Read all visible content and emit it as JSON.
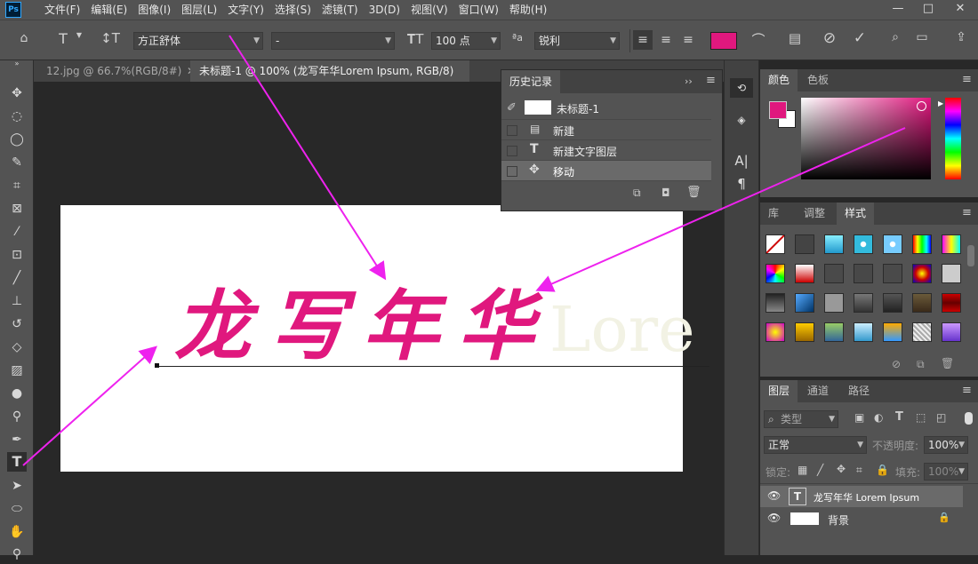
{
  "app": {
    "logo": "Ps",
    "brand_color": "#31a8ff"
  },
  "menu": [
    "文件(F)",
    "编辑(E)",
    "图像(I)",
    "图层(L)",
    "文字(Y)",
    "选择(S)",
    "滤镜(T)",
    "3D(D)",
    "视图(V)",
    "窗口(W)",
    "帮助(H)"
  ],
  "window_controls": {
    "minimize": "—",
    "maximize": "□",
    "close": "✕"
  },
  "options": {
    "font_family": "方正舒体",
    "font_style": "-",
    "font_size": "100 点",
    "aa_label": "ªa",
    "antialias": "锐利",
    "text_color": "#e0187e"
  },
  "tabs": [
    {
      "label": "12.jpg @ 66.7%(RGB/8#)",
      "close": "✕"
    },
    {
      "label": "未标题-1 @ 100% (龙写年华Lorem Ipsum, RGB/8) *",
      "close": "✕"
    }
  ],
  "canvas": {
    "text_glyphs": [
      "龙",
      "写",
      "年",
      "华"
    ],
    "placeholder_text": "Lore"
  },
  "history": {
    "title": "历史记录",
    "collapse": "››",
    "snapshot": "未标题-1",
    "items": [
      "新建",
      "新建文字图层",
      "移动"
    ]
  },
  "color_panel": {
    "tabs": [
      "颜色",
      "色板"
    ],
    "foreground": "#e0187e",
    "background": "#ffffff"
  },
  "styles_panel": {
    "tabs": [
      "库",
      "调整",
      "样式"
    ]
  },
  "layers_panel": {
    "tabs": [
      "图层",
      "通道",
      "路径"
    ],
    "filter_label": "类型",
    "blend_mode": "正常",
    "opacity_label": "不透明度:",
    "opacity": "100%",
    "lock_label": "锁定:",
    "fill_label": "填充:",
    "fill": "100%",
    "layers": [
      {
        "name": "龙写年华 Lorem Ipsum",
        "type": "text"
      },
      {
        "name": "背景",
        "type": "background",
        "locked": true
      }
    ]
  },
  "annotation_color": "#ee22ee"
}
